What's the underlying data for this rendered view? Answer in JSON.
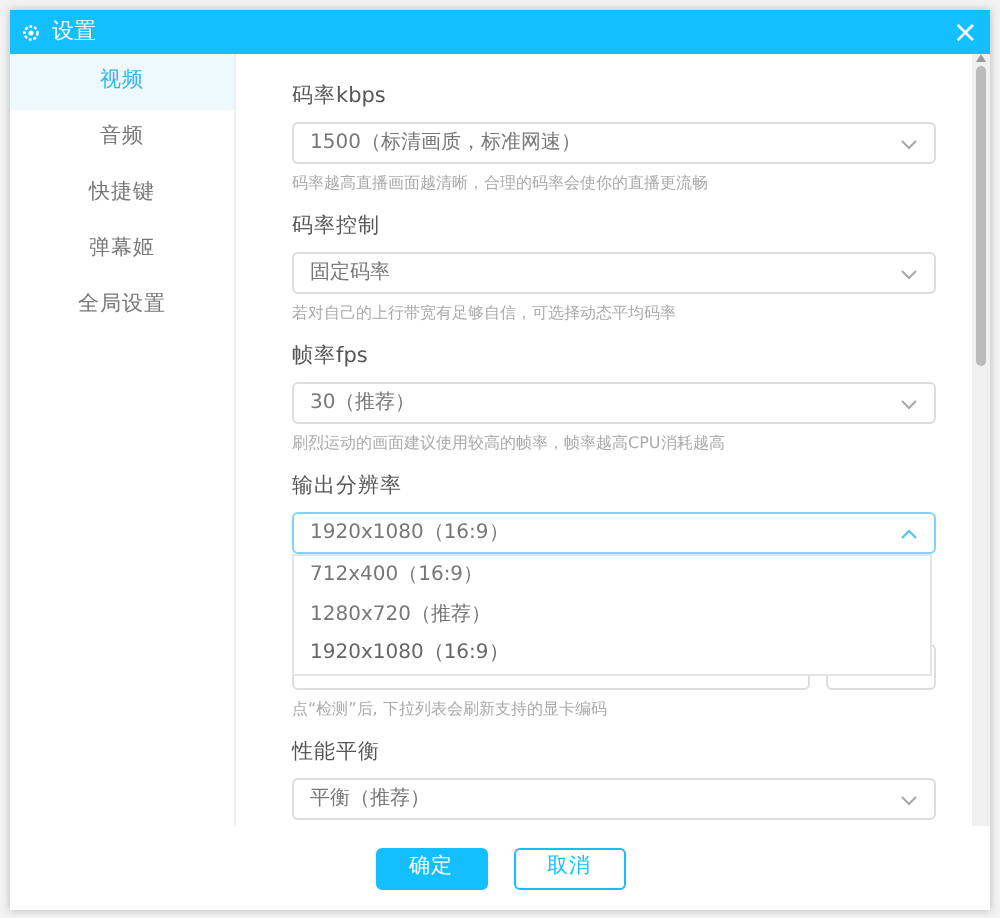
{
  "window": {
    "title": "设置",
    "close": "×"
  },
  "sidebar": {
    "items": [
      {
        "label": "视频",
        "selected": true
      },
      {
        "label": "音频",
        "selected": false
      },
      {
        "label": "快捷键",
        "selected": false
      },
      {
        "label": "弹幕姬",
        "selected": false
      },
      {
        "label": "全局设置",
        "selected": false
      }
    ]
  },
  "fields": [
    {
      "kind": "select",
      "label": "码率kbps",
      "value": "1500（标清画质，标准网速）",
      "hint": "码率越高直播画面越清晰，合理的码率会使你的直播更流畅",
      "expanded": false
    },
    {
      "kind": "select",
      "label": "码率控制",
      "value": "固定码率",
      "hint": "若对自己的上行带宽有足够自信，可选择动态平均码率",
      "expanded": false
    },
    {
      "kind": "select",
      "label": "帧率fps",
      "value": "30（推荐）",
      "hint": "刷烈运动的画面建议使用较高的帧率，帧率越高CPU消耗越高",
      "expanded": false
    },
    {
      "kind": "select",
      "label": "输出分辨率",
      "value": "1920x1080（16:9）",
      "expanded": true,
      "options": [
        {
          "label": "712x400（16:9）",
          "selected": false
        },
        {
          "label": "1280x720（推荐）",
          "selected": false
        },
        {
          "label": "1920x1080（16:9）",
          "selected": true
        }
      ]
    },
    {
      "kind": "encoder",
      "hint": "点“检测”后, 下拉列表会刷新支持的显卡编码"
    },
    {
      "kind": "select",
      "label": "性能平衡",
      "value": "平衡（推荐）",
      "expanded": false
    }
  ],
  "buttons": [
    {
      "label": "确定",
      "primary": true
    },
    {
      "label": "取消",
      "primary": false
    }
  ]
}
